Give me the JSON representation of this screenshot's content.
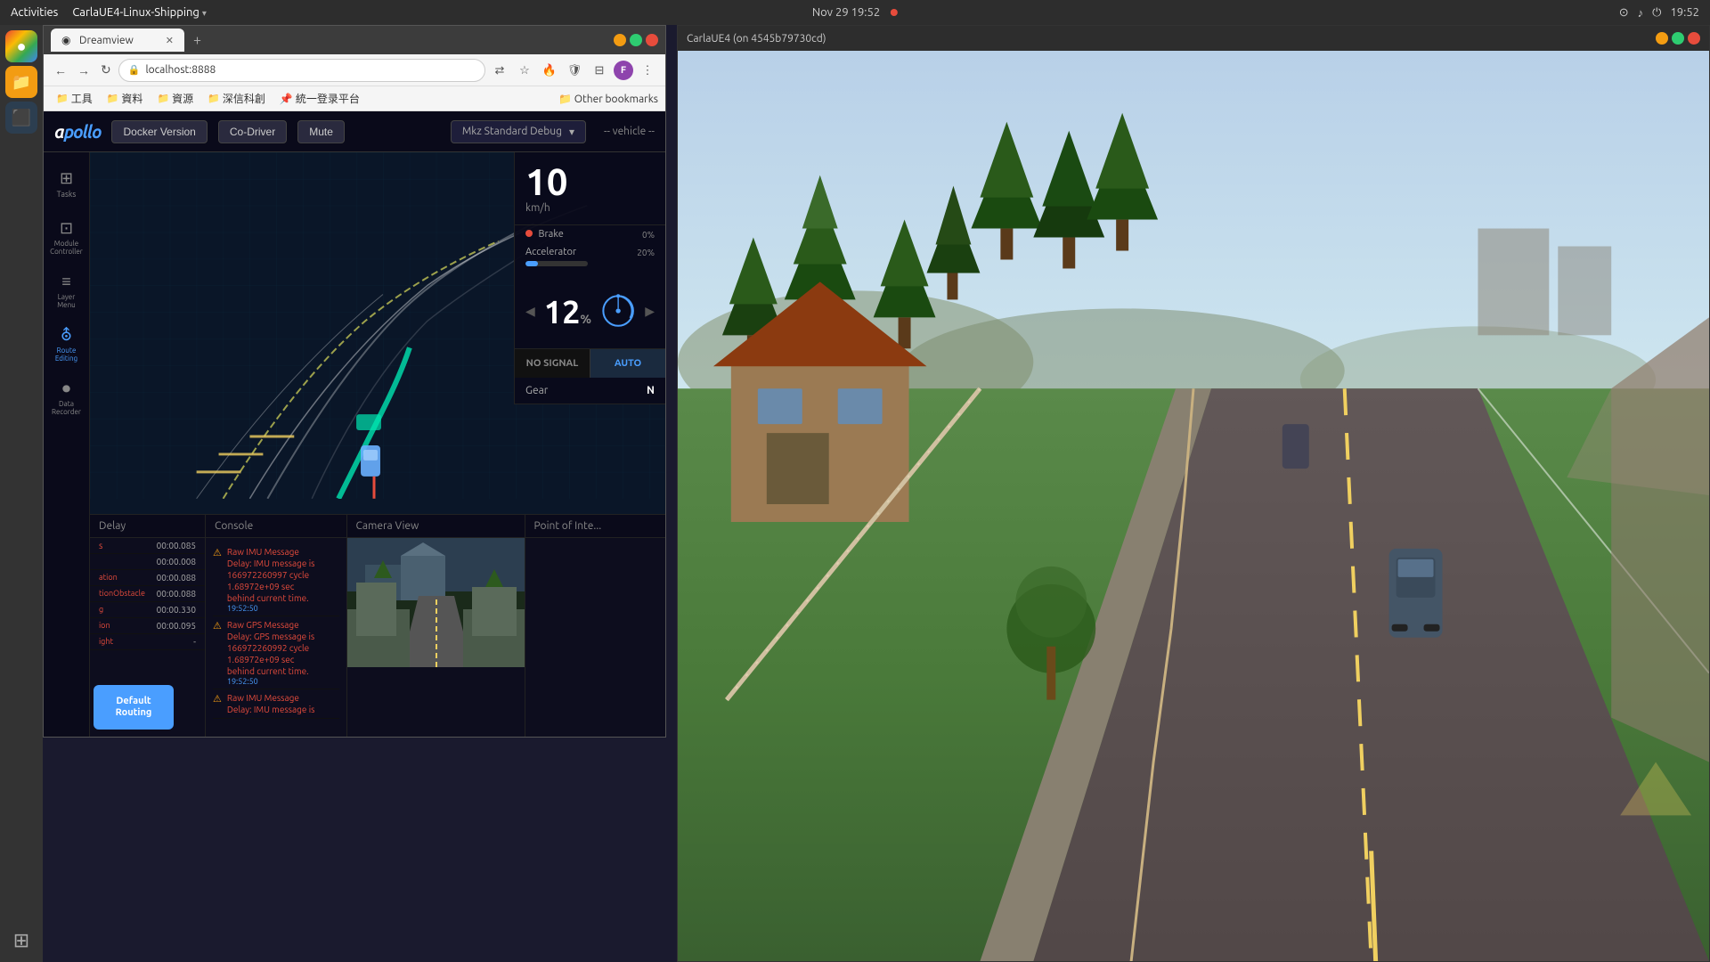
{
  "system_bar": {
    "activities": "Activities",
    "app_name": "CarlaUE4-Linux-Shipping",
    "dropdown": "▾",
    "datetime": "Nov 29  19:52",
    "status_indicator": "●"
  },
  "browser": {
    "tab": {
      "favicon": "◉",
      "title": "Dreamview",
      "close": "✕"
    },
    "new_tab": "+",
    "window_controls": {
      "minimize": "_",
      "maximize": "□",
      "close": "✕"
    },
    "nav": {
      "back": "←",
      "forward": "→",
      "reload": "↻",
      "url": "localhost:8888"
    },
    "bookmarks": [
      {
        "icon": "📁",
        "label": "工具"
      },
      {
        "icon": "📁",
        "label": "資料"
      },
      {
        "icon": "📁",
        "label": "資源"
      },
      {
        "icon": "📁",
        "label": "深信科創"
      },
      {
        "icon": "📌",
        "label": "統一登录平台"
      },
      {
        "sep": "|"
      },
      {
        "icon": "📁",
        "label": "Other bookmarks"
      }
    ],
    "toolbar_icons": [
      "⇄",
      "★",
      "🔥",
      "🛡",
      "⊟",
      "F"
    ],
    "more": "⋮"
  },
  "apollo": {
    "logo": "apollo",
    "header_buttons": [
      {
        "label": "Docker Version"
      },
      {
        "label": "Co-Driver"
      },
      {
        "label": "Mute"
      }
    ],
    "vehicle_selector": {
      "label": "Mkz Standard Debug",
      "vehicle_placeholder": "-- vehicle --"
    },
    "sidebar": [
      {
        "icon": "⊞",
        "label": "Tasks"
      },
      {
        "icon": "⊡",
        "label": "Module\nController"
      },
      {
        "icon": "≡",
        "label": "Layer\nMenu"
      },
      {
        "icon": "⛢",
        "label": "Route\nEditing",
        "active": true
      },
      {
        "icon": "⏺",
        "label": "Data\nRecorder"
      }
    ],
    "speed": {
      "value": "10",
      "unit": "km/h"
    },
    "brake": {
      "label": "Brake",
      "percent": "0%",
      "indicator": "●"
    },
    "accelerator": {
      "label": "Accelerator",
      "percent": "20%",
      "bar_width": "20"
    },
    "heading": {
      "value": "12",
      "unit": "%"
    },
    "signal": {
      "no_signal": "NO SIGNAL",
      "auto": "AUTO"
    },
    "gear": {
      "label": "Gear",
      "value": "N"
    },
    "routing_btn": "Default\nRouting"
  },
  "bottom_panels": {
    "delay": {
      "header": "Delay",
      "rows": [
        {
          "label": "s",
          "value": "00:00.085"
        },
        {
          "label": "",
          "value": "00:00.008"
        },
        {
          "label": "ation",
          "value": "00:00.088"
        },
        {
          "label": "tionObstacle",
          "value": "00:00.088"
        },
        {
          "label": "g",
          "value": "00:00.330"
        },
        {
          "label": "ion",
          "value": "00:00.095"
        },
        {
          "label": "ight",
          "value": "-"
        }
      ]
    },
    "console": {
      "header": "Console",
      "messages": [
        {
          "icon": "⚠",
          "text": "Raw IMU Message\nDelay: IMU message is\n166972260997 cycle\n1.68972e+09 sec\nbehind current time.",
          "timestamp": "19:52:50"
        },
        {
          "icon": "⚠",
          "text": "Raw GPS Message\nDelay: GPS message is\n166972260992 cycle\n1.68972e+09 sec\nbehind current time.",
          "timestamp": "19:52:50"
        },
        {
          "icon": "⚠",
          "text": "Raw IMU Message\nDelay: IMU message is",
          "timestamp": ""
        }
      ]
    },
    "camera": {
      "header": "Camera View"
    },
    "poi": {
      "header": "Point of Inte..."
    }
  },
  "carla": {
    "title": "CarlaUE4   (on 4545b79730cd)",
    "controls": {
      "minimize": "_",
      "maximize": "□",
      "close": "✕"
    }
  }
}
